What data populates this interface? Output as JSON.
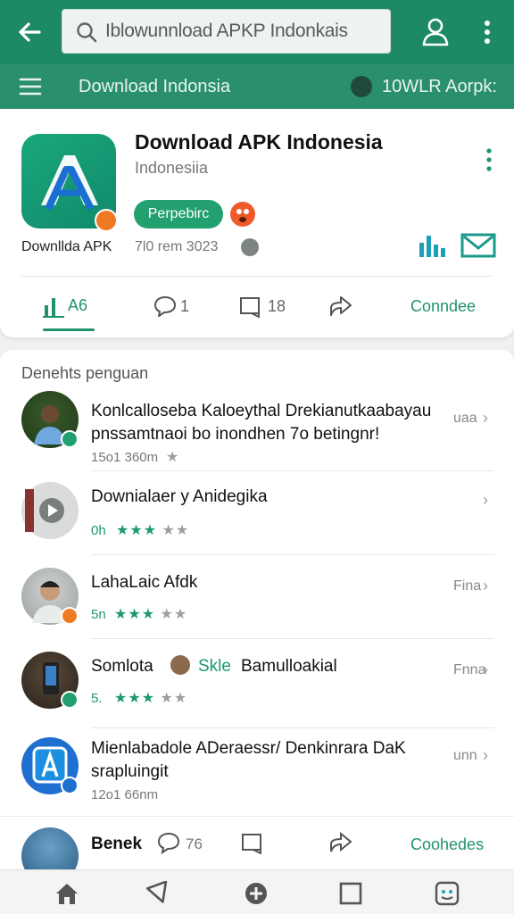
{
  "toolbar": {
    "search_text": "Iblowunnload APKP Indonkais"
  },
  "subbar": {
    "title": "Download Indonsia",
    "right_text": "10WLR Aorpk:"
  },
  "app": {
    "name": "Download APK Indonesia",
    "subtitle": "Indonesiia",
    "pill_label": "Perpebirc",
    "developer": "Downllda APK",
    "date": "7l0 rem 3023",
    "actions": {
      "likes": "A6",
      "comments": "1",
      "saves": "18",
      "cta": "Conndee"
    }
  },
  "list": {
    "section_title": "Denehts penguan",
    "rows": [
      {
        "title": "Konlcalloseba Kaloeythal Drekianutkaabayau",
        "line2": "pnssamtnaoi bo inondhen 7o betingnr!",
        "meta": "15o1 360m",
        "right": "uaa"
      },
      {
        "title": "Downialaer y Anidegika",
        "meta": "0h",
        "right": ""
      },
      {
        "title": "LahaLaic Afdk",
        "meta": "5n",
        "right": "Fina"
      },
      {
        "title": "Somlota",
        "title_green": "Skle",
        "title_rest": "Bamulloakial",
        "meta": "5.",
        "right": "Fnna"
      },
      {
        "title": "Mienlabadole ADeraessr/ Denkinrara DaK",
        "line2": "srapluingit",
        "meta": "12o1 66nm",
        "right": "unn"
      }
    ]
  },
  "bottom_row": {
    "title": "Benek",
    "comments": "76",
    "cta": "Coohedes"
  },
  "colors": {
    "primary": "#1e8a63",
    "accent": "#21936b",
    "badge_orange": "#f07a24"
  }
}
